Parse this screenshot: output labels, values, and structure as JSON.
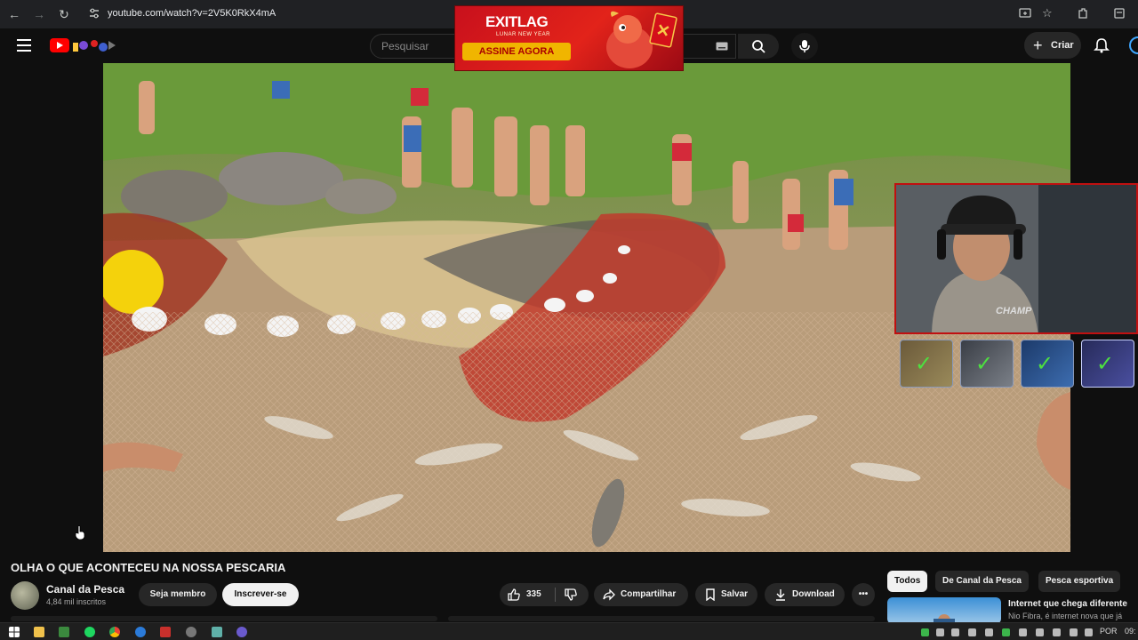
{
  "browser": {
    "url": "youtube.com/watch?v=2V5K0RkX4mA"
  },
  "header": {
    "search_placeholder": "Pesquisar",
    "create_label": "Criar"
  },
  "ad": {
    "brand": "EXITLAG",
    "tagline": "LUNAR NEW YEAR",
    "cta": "ASSINE AGORA"
  },
  "webcam": {
    "overlay_label": "CHAMP"
  },
  "video": {
    "title": "OLHA O QUE ACONTECEU NA NOSSA PESCARIA"
  },
  "channel": {
    "name": "Canal da Pesca",
    "subscribers": "4,84 mil inscritos",
    "join_label": "Seja membro",
    "subscribe_label": "Inscrever-se"
  },
  "actions": {
    "likes": "335",
    "share_label": "Compartilhar",
    "save_label": "Salvar",
    "download_label": "Download",
    "more_label": "•••"
  },
  "chips": {
    "all": "Todos",
    "channel": "De Canal da Pesca",
    "sport": "Pesca esportiva"
  },
  "recommendation": {
    "title": "Internet que chega diferente",
    "subtitle": "Nio Fibra, é internet nova que já"
  },
  "taskbar": {
    "language": "POR",
    "clock": "09:"
  },
  "colors": {
    "accent_red": "#ff0000",
    "background": "#0f0f0f",
    "check_green": "#4de040",
    "webcam_border": "#c01010"
  }
}
